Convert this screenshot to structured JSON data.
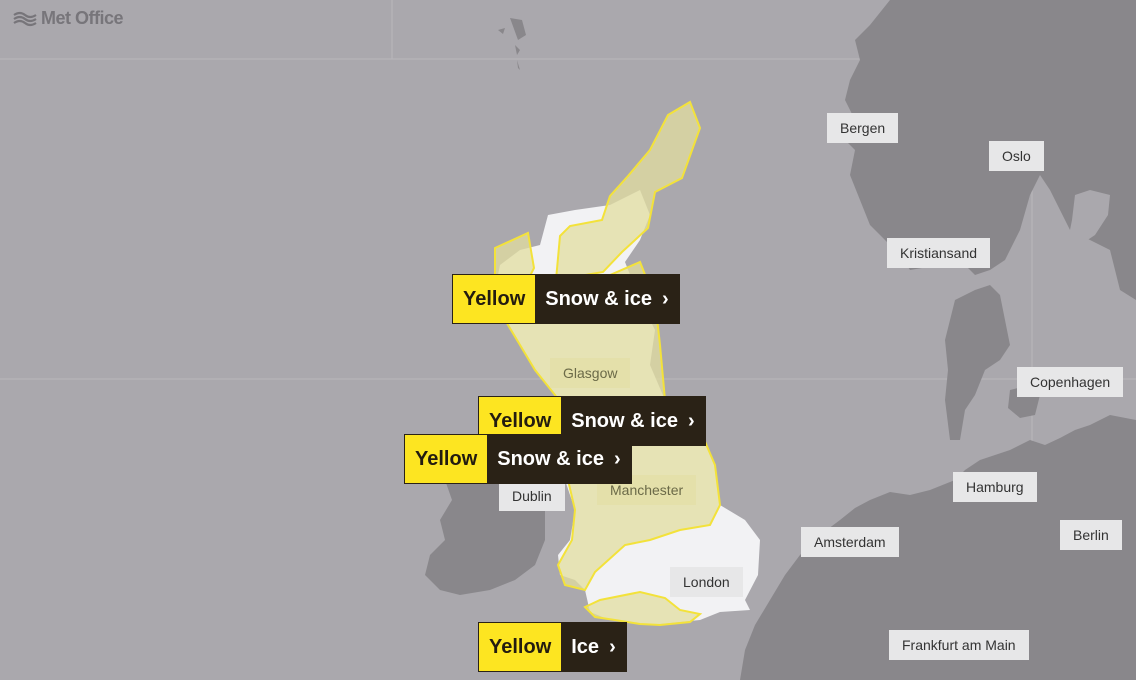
{
  "brand": {
    "name": "Met Office",
    "logo_icon": "met-office-waves-icon"
  },
  "colors": {
    "sea": "#aaa8ad",
    "foreign_land": "#89878b",
    "uk_land": "#f2f2f4",
    "warning_fill": "#e2dea0",
    "warning_border": "#f3e23a",
    "warning_badge_level": "#fde521",
    "warning_badge_type": "#2a2216"
  },
  "cities": [
    {
      "name": "Bergen"
    },
    {
      "name": "Oslo"
    },
    {
      "name": "Kristiansand"
    },
    {
      "name": "Glasgow"
    },
    {
      "name": "Copenhagen"
    },
    {
      "name": "Manchester"
    },
    {
      "name": "Dublin"
    },
    {
      "name": "Hamburg"
    },
    {
      "name": "Amsterdam"
    },
    {
      "name": "Berlin"
    },
    {
      "name": "London"
    },
    {
      "name": "Frankfurt am Main"
    }
  ],
  "warnings": [
    {
      "level": "Yellow",
      "type": "Snow & ice",
      "chevron": "›"
    },
    {
      "level": "Yellow",
      "type": "Snow & ice",
      "chevron": "›"
    },
    {
      "level": "Yellow",
      "type": "Snow & ice",
      "chevron": "›"
    },
    {
      "level": "Yellow",
      "type": "Ice",
      "chevron": "›"
    }
  ]
}
